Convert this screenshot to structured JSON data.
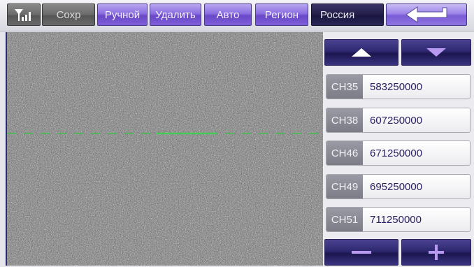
{
  "toolbar": {
    "signal_icon": "signal-bars-icon",
    "save_label": "Сохр",
    "manual_label": "Ручной",
    "delete_label": "Удалить",
    "auto_label": "Авто",
    "region_label": "Регион",
    "region_value": "Россия",
    "back_icon": "return-arrow-icon"
  },
  "panel": {
    "up_icon": "triangle-up-icon",
    "down_icon": "chevron-down-icon",
    "channels": [
      {
        "channel": "CH35",
        "frequency": "583250000"
      },
      {
        "channel": "CH38",
        "frequency": "607250000"
      },
      {
        "channel": "CH46",
        "frequency": "671250000"
      },
      {
        "channel": "CH49",
        "frequency": "695250000"
      },
      {
        "channel": "CH51",
        "frequency": "711250000"
      }
    ],
    "minus_icon": "minus-icon",
    "plus_icon": "plus-icon"
  },
  "colors": {
    "accent_purple": "#7d5ed8",
    "dark_navy": "#221e48",
    "noise_gray": "#6e6e6e",
    "scanline_green": "#3fbf4f"
  }
}
